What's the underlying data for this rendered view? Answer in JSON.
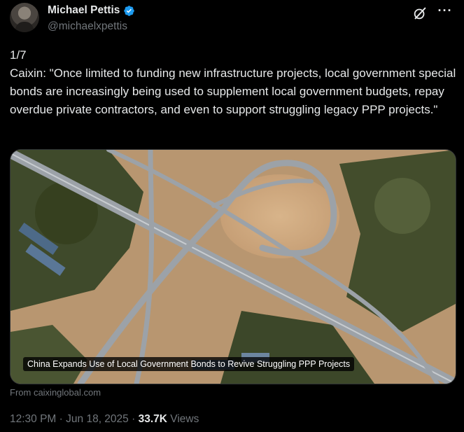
{
  "author": {
    "display_name": "Michael Pettis",
    "handle": "@michaelxpettis"
  },
  "icons": {
    "verified": "verified-badge-icon",
    "grok": "grok-icon",
    "more": "more-icon"
  },
  "tweet": {
    "counter": "1/7",
    "body": "Caixin: \"Once limited to funding new infrastructure projects, local government special bonds are increasingly being used to supplement local government budgets, repay overdue private contractors, and even to support struggling legacy PPP projects.\""
  },
  "card": {
    "caption": "China Expands Use of Local Government Bonds to Revive Struggling PPP Projects",
    "source": "From caixinglobal.com"
  },
  "meta": {
    "time": "12:30 PM",
    "separator": "·",
    "date": "Jun 18, 2025",
    "views_count": "33.7K",
    "views_label": "Views"
  },
  "colors": {
    "background": "#000000",
    "text": "#e7e9ea",
    "muted": "#71767b",
    "verified": "#1d9bf0"
  }
}
